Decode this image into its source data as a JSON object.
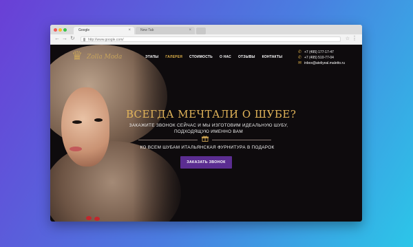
{
  "browser": {
    "tabs": [
      {
        "label": "Google"
      },
      {
        "label": "New Tab"
      }
    ],
    "url": "http://www.google.com/"
  },
  "site": {
    "logo_text": "Zolla Moda",
    "menu": [
      "ЭТАПЫ",
      "ГАЛЕРЕЯ",
      "СТОИМОСТЬ",
      "О НАС",
      "ОТЗЫВЫ",
      "КОНТАКТЫ"
    ],
    "active_menu": "ГАЛЕРЕЯ",
    "phones": [
      "+7 (495) 177-17-47",
      "+7 (495) 510-77-04"
    ],
    "email": "inbox@ateliyeal.maletto.ru"
  },
  "hero": {
    "title": "ВСЕГДА МЕЧТАЛИ О ШУБЕ?",
    "subtitle_line1": "ЗАКАЖИТЕ ЗВОНОК СЕЙЧАС И МЫ ИЗГОТОВИМ ИДЕАЛЬНУЮ ШУБУ,",
    "subtitle_line2": "ПОДХОДЯЩУЮ ИМЕННО ВАМ",
    "gift_text": "КО ВСЕМ ШУБАМ ИТАЛЬЯНСКАЯ ФУРНИТУРА В ПОДАРОК",
    "cta_label": "ЗАКАЗАТЬ ЗВОНОК"
  },
  "colors": {
    "accent_gold": "#e3b55a",
    "cta_purple": "#5b2d91",
    "background_gradient_start": "#6a3fd6",
    "background_gradient_end": "#2cc6e8"
  },
  "icons": {
    "phone": "phone-icon",
    "mail": "mail-icon",
    "gift": "gift-icon"
  }
}
